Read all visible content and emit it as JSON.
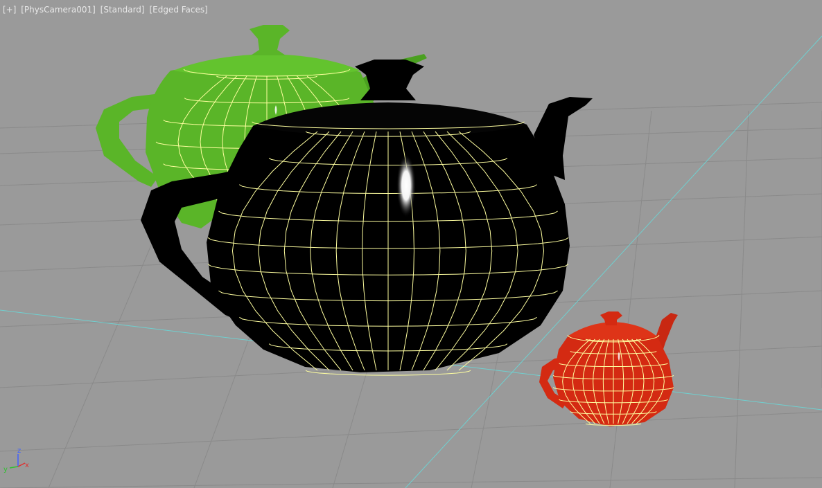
{
  "viewport": {
    "labels": {
      "plus_menu": "[+]",
      "point_of_view": "[PhysCamera001]",
      "shading_mode": "[Standard]",
      "display_mode": "[Edged Faces]"
    },
    "background_color": "#9a9a9a",
    "grid_color": "#8a8a8a",
    "home_grid_axis_color": "#6fd0d0",
    "wire_color": "#ffffa0"
  },
  "objects": [
    {
      "name": "Teapot (green)",
      "color": "#5ab528",
      "shade": "#2f7a12"
    },
    {
      "name": "Teapot (black)",
      "color": "#000000",
      "shade": "#000000"
    },
    {
      "name": "Teapot (red)",
      "color": "#d42a12",
      "shade": "#8e1608"
    }
  ],
  "axis_tripod": {
    "x_label": "x",
    "y_label": "y",
    "z_label": "z",
    "x_color": "#e03030",
    "y_color": "#30c030",
    "z_color": "#4060ff"
  }
}
